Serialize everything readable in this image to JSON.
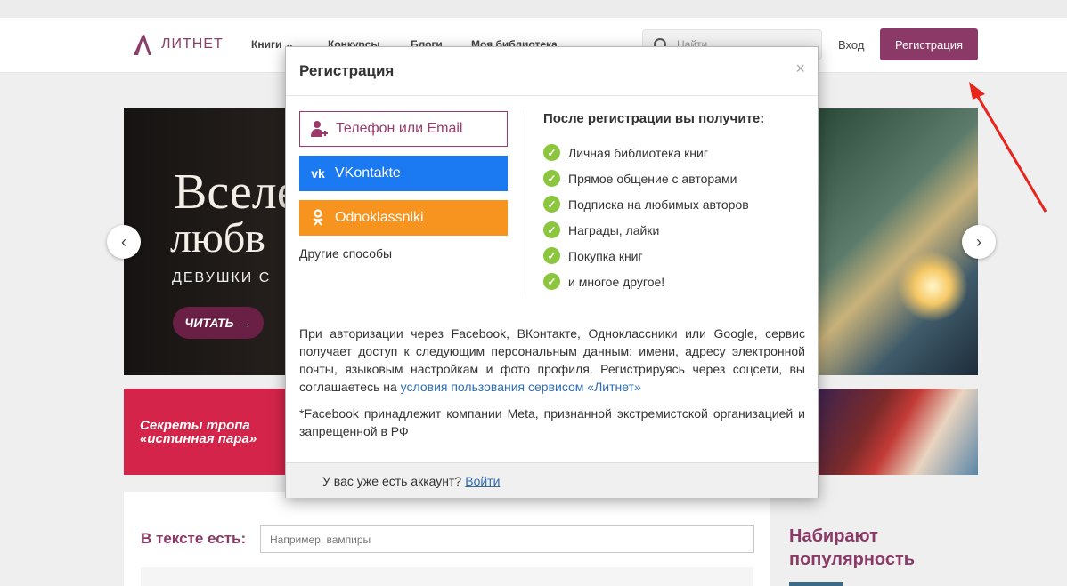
{
  "header": {
    "logo_text": "ЛИТНЕТ",
    "nav": [
      "Книги",
      "Конкурсы",
      "Блоги",
      "Моя библиотека"
    ],
    "search_placeholder": "Найти",
    "login_label": "Вход",
    "register_label": "Регистрация"
  },
  "banner": {
    "title_line1": "Вселе",
    "title_line2": "любв",
    "subtitle": "ДЕВУШКИ С",
    "read_label": "ЧИТАТЬ",
    "prev": "‹",
    "next": "›"
  },
  "banner2": {
    "line1": "Секреты тропа",
    "line2": "«истинная пара»"
  },
  "content": {
    "intext_label": "В тексте есть:",
    "intext_placeholder": "Например, вампиры",
    "side_title_line1": "Набирают",
    "side_title_line2": "популярность"
  },
  "modal": {
    "title": "Регистрация",
    "close": "×",
    "options": {
      "phone_email": "Телефон или Email",
      "vk": "VKontakte",
      "ok": "Odnoklassniki"
    },
    "other_ways": "Другие способы",
    "benefits_title": "После регистрации вы получите:",
    "benefits": [
      "Личная библиотека книг",
      "Прямое общение с авторами",
      "Подписка на любимых авторов",
      "Награды, лайки",
      "Покупка книг",
      "и многое другое!"
    ],
    "policy_text": "При авторизации через Facebook, ВКонтакте, Одноклассники или Google, сервис получает доступ к следующим персональным данным: имени, адресу электронной почты, языковым настройкам и фото профиля. Регистрируясь через соцсети, вы соглашаетесь на ",
    "policy_link": "условия пользования сервисом «Литнет»",
    "meta_note": "*Facebook принадлежит компании Meta, признанной экстремистской организацией и запрещенной в РФ",
    "footer_question": "У вас уже есть аккаунт?",
    "footer_login": "Войти"
  },
  "colors": {
    "brand": "#8b3a67",
    "vk": "#1b79f1",
    "ok": "#f7931f",
    "check": "#8cc63f",
    "link": "#2d6db5",
    "annotation_arrow": "#e8241c"
  }
}
